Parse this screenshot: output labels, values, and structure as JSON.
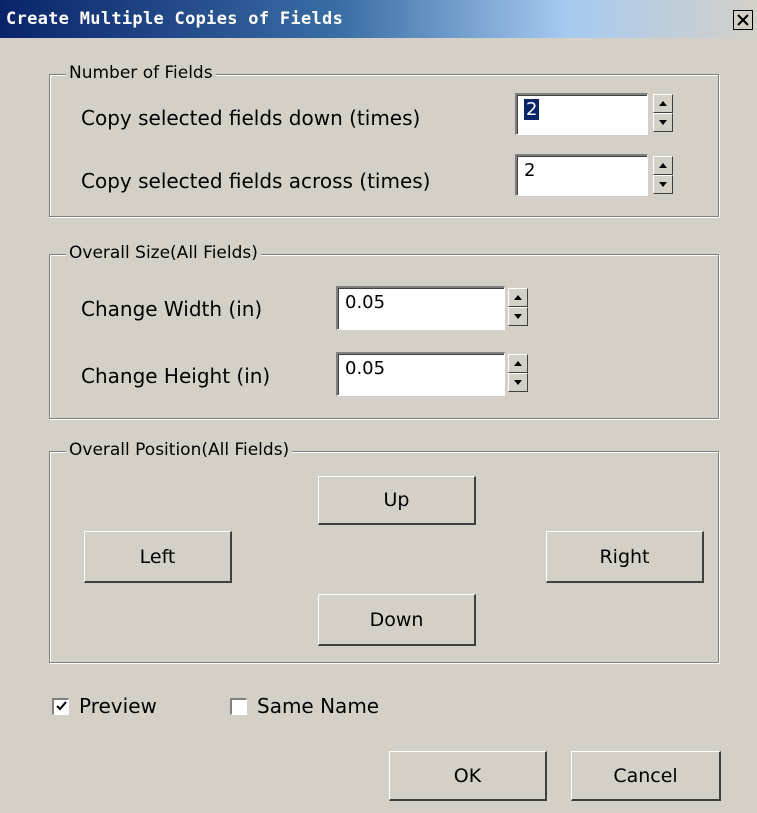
{
  "window": {
    "title": "Create Multiple Copies of Fields",
    "close_icon": "close-icon"
  },
  "number_of_fields": {
    "legend": "Number of Fields",
    "copy_down_label": "Copy selected fields down (times)",
    "copy_down_value": "2",
    "copy_across_label": "Copy selected fields across (times)",
    "copy_across_value": "2"
  },
  "overall_size": {
    "legend": "Overall Size(All Fields)",
    "width_label": "Change Width (in)",
    "width_value": "0.05",
    "height_label": "Change Height (in)",
    "height_value": "0.05"
  },
  "overall_position": {
    "legend": "Overall Position(All Fields)",
    "up_label": "Up",
    "left_label": "Left",
    "right_label": "Right",
    "down_label": "Down"
  },
  "options": {
    "preview_label": "Preview",
    "preview_checked": true,
    "same_name_label": "Same Name",
    "same_name_checked": false
  },
  "footer": {
    "ok_label": "OK",
    "cancel_label": "Cancel"
  },
  "colors": {
    "dialog_bg": "#d4d0c8",
    "title_bar_start": "#0a246a",
    "title_bar_end": "#a6caf0",
    "selection": "#0a246a"
  }
}
